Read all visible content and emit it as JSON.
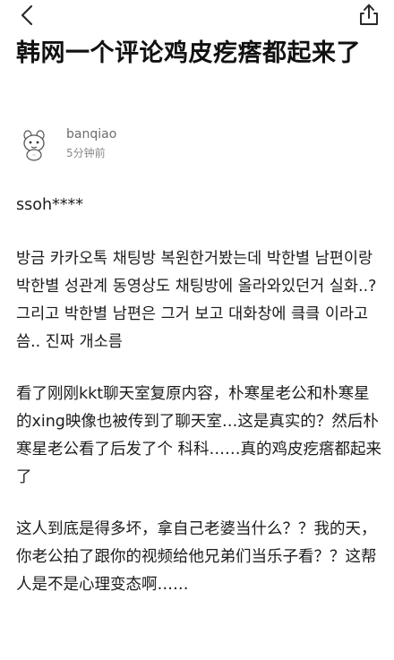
{
  "nav": {
    "back_icon": "chevron-left-icon",
    "share_icon": "share-icon"
  },
  "article": {
    "title": "韩网一个评论鸡皮疙瘩都起来了",
    "author": "banqiao",
    "time": "5分钟前",
    "avatar_icon": "cartoon-avatar",
    "paragraphs": [
      "ssoh****",
      "방금 카카오톡 채팅방 복원한거봤는데 박한별 남편이랑 박한별 성관계 동영상도 채팅방에 올라와있던거 실화..? 그리고 박한별 남편은 그거 보고 대화창에 킄킄 이라고 씀.. 진짜 개소름",
      "看了刚刚kkt聊天室复原内容，朴寒星老公和朴寒星的xing映像也被传到了聊天室…这是真实的？然后朴寒星老公看了后发了个 科科……真的鸡皮疙瘩都起来了",
      "这人到底是得多坏，拿自己老婆当什么？？我的天，你老公拍了跟你的视频给他兄弟们当乐子看？？这帮人是不是心理变态啊……"
    ]
  },
  "colors": {
    "text": "#1c1c1c",
    "meta": "#8a8a8a",
    "background": "#ffffff"
  }
}
